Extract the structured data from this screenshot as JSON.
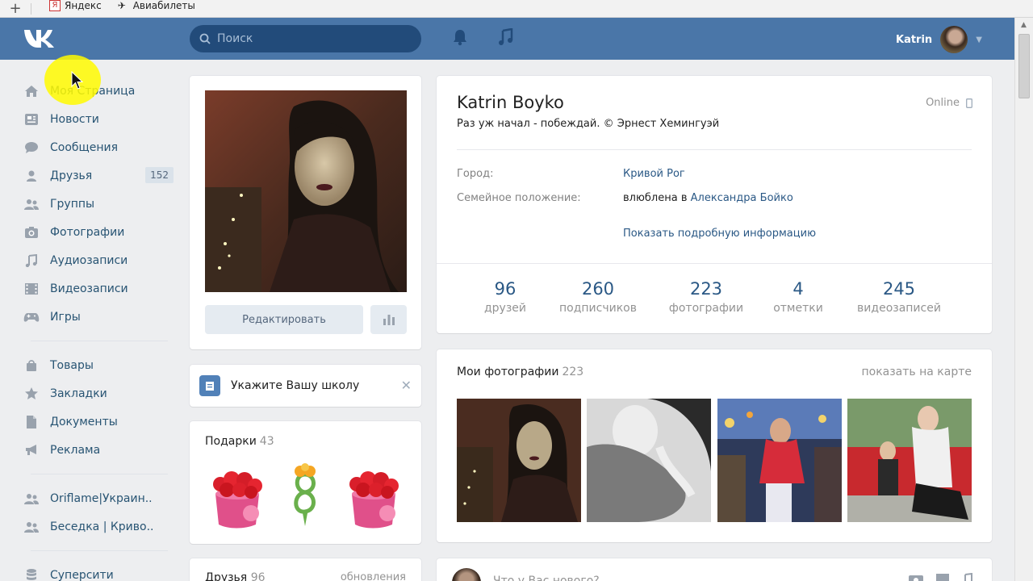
{
  "browser": {
    "bookmarks": [
      {
        "label": "Яндекс",
        "icon": "yandex-icon"
      },
      {
        "label": "Авиабилеты",
        "icon": "plane-icon"
      }
    ]
  },
  "header": {
    "search_placeholder": "Поиск",
    "user_name": "Katrin"
  },
  "menu": {
    "items": [
      {
        "label": "Моя Страница",
        "icon": "home-icon"
      },
      {
        "label": "Новости",
        "icon": "news-icon"
      },
      {
        "label": "Сообщения",
        "icon": "messages-icon"
      },
      {
        "label": "Друзья",
        "icon": "friends-icon",
        "badge": "152"
      },
      {
        "label": "Группы",
        "icon": "groups-icon"
      },
      {
        "label": "Фотографии",
        "icon": "camera-icon"
      },
      {
        "label": "Аудиозаписи",
        "icon": "music-icon"
      },
      {
        "label": "Видеозаписи",
        "icon": "video-icon"
      },
      {
        "label": "Игры",
        "icon": "gamepad-icon"
      }
    ],
    "items2": [
      {
        "label": "Товары",
        "icon": "bag-icon"
      },
      {
        "label": "Закладки",
        "icon": "star-icon"
      },
      {
        "label": "Документы",
        "icon": "document-icon"
      },
      {
        "label": "Реклама",
        "icon": "megaphone-icon"
      }
    ],
    "items3": [
      {
        "label": "Oriflame|Украин..",
        "icon": "group-icon"
      },
      {
        "label": "Беседка | Криво..",
        "icon": "group-icon"
      }
    ],
    "items4": [
      {
        "label": "Суперсити",
        "icon": "stack-icon"
      }
    ]
  },
  "avatar_card": {
    "edit_label": "Редактировать"
  },
  "school": {
    "text": "Укажите Вашу школу"
  },
  "gifts": {
    "title": "Подарки",
    "count": "43"
  },
  "friends_block": {
    "title": "Друзья",
    "count": "96",
    "updates": "обновления"
  },
  "profile": {
    "name": "Katrin Boyko",
    "status": "Раз уж начал - побеждай. © Эрнест Хемингуэй",
    "online": "Online",
    "city_label": "Город:",
    "city": "Кривой Рог",
    "relation_label": "Семейное положение:",
    "relation_prefix": "влюблена в",
    "relation_partner": "Александра Бойко",
    "more_info": "Показать подробную информацию",
    "stats": [
      {
        "value": "96",
        "label": "друзей"
      },
      {
        "value": "260",
        "label": "подписчиков"
      },
      {
        "value": "223",
        "label": "фотографии"
      },
      {
        "value": "4",
        "label": "отметки"
      },
      {
        "value": "245",
        "label": "видеозаписей"
      }
    ]
  },
  "photos": {
    "title": "Мои фотографии",
    "count": "223",
    "map_link": "показать на карте"
  },
  "post": {
    "placeholder": "Что у Вас нового?"
  },
  "colors": {
    "header": "#4a76a8",
    "link": "#2a5885",
    "background": "#edeef0"
  }
}
